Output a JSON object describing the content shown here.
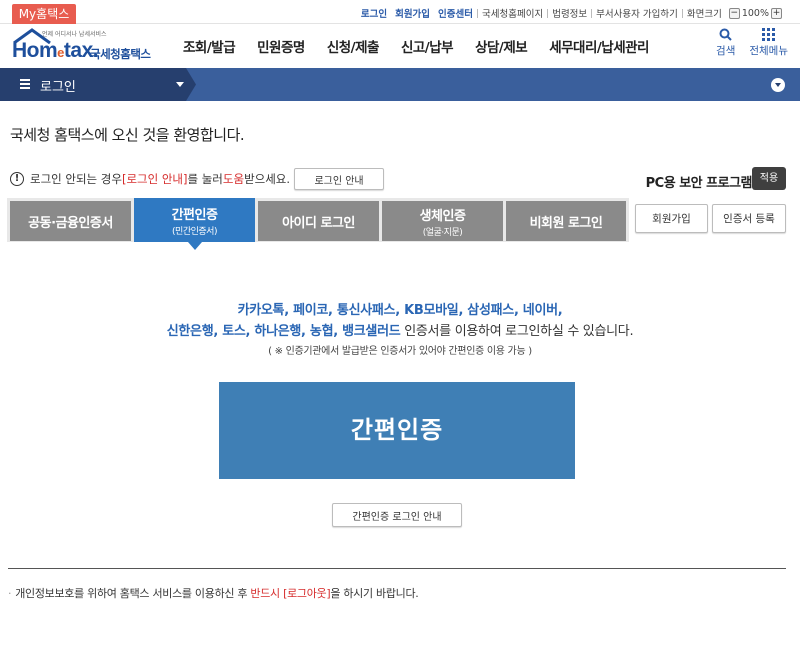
{
  "util": {
    "my_tab": "My홈택스",
    "links": [
      "로그인",
      "회원가입",
      "인증센터",
      "국세청홈페이지",
      "법령정보",
      "부서사용자 가입하기",
      "화면크기"
    ],
    "zoom_minus": "−",
    "zoom_value": "100%",
    "zoom_plus": "+"
  },
  "header": {
    "logo_sub": "언제 어디서나 납세서비스",
    "logo_main_a": "Hom",
    "logo_main_e": "e",
    "logo_main_b": "tax.",
    "logo_side": "국세청홈택스",
    "nav": [
      "조회/발급",
      "민원증명",
      "신청/제출",
      "신고/납부",
      "상담/제보",
      "세무대리/납세관리"
    ],
    "search_label": "검색",
    "menu_label": "전체메뉴"
  },
  "locbar": {
    "title": "로그인"
  },
  "welcome": "국세청 홈택스에 오신 것을 환영합니다.",
  "notice": {
    "pre": "로그인 안되는 경우 ",
    "red1": "[로그인 안내]",
    "mid": "를 눌러 ",
    "red2": "도움",
    "post": "받으세요.",
    "button": "로그인 안내"
  },
  "security": {
    "label": "PC용 보안 프로그램",
    "apply": "적용"
  },
  "tabs": [
    {
      "label": "공동·금융인증서",
      "sub": ""
    },
    {
      "label": "간편인증",
      "sub": "(민간인증서)"
    },
    {
      "label": "아이디 로그인",
      "sub": ""
    },
    {
      "label": "생체인증",
      "sub": "(얼굴·지문)"
    },
    {
      "label": "비회원 로그인",
      "sub": ""
    }
  ],
  "side_buttons": {
    "join": "회원가입",
    "cert_register": "인증서 등록"
  },
  "main": {
    "line1": "카카오톡, 페이코, 통신사패스, KB모바일, 삼성패스, 네이버,",
    "line2_blue": "신한은행, 토스, 하나은행, 농협, 뱅크샐러드",
    "line2_plain": " 인증서를 이용하여 로그인하실 수 있습니다.",
    "line3": "( ※ 인증기관에서 발급받은 인증서가 있어야 간편인증 이용 가능 )",
    "big_button": "간편인증",
    "guide_button": "간편인증 로그인 안내"
  },
  "footnote": {
    "bullet": "·",
    "pre": "개인정보보호를 위하여 홈택스 서비스를 이용하신 후 ",
    "red": "반드시 [로그아웃]",
    "post": "을 하시기 바랍니다."
  },
  "colors": {
    "my_tab": "#e85c4f",
    "active_tab": "#2f79c2",
    "inactive_tab": "#8a8a8a",
    "locbar": "#3a5f9c",
    "big_button": "#3f7fb5",
    "highlight_red": "#d62b2b"
  }
}
